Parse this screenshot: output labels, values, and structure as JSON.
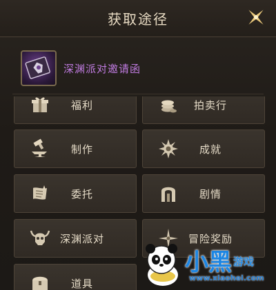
{
  "header": {
    "title": "获取途径"
  },
  "item": {
    "name": "深渊派对邀请函"
  },
  "sources": [
    {
      "label": "福利",
      "icon": "gift-icon"
    },
    {
      "label": "拍卖行",
      "icon": "coin-stack-icon"
    },
    {
      "label": "制作",
      "icon": "anvil-hammer-icon"
    },
    {
      "label": "成就",
      "icon": "medal-icon"
    },
    {
      "label": "委托",
      "icon": "scroll-icon"
    },
    {
      "label": "剧情",
      "icon": "gate-icon"
    },
    {
      "label": "深渊派对",
      "icon": "horned-skull-icon"
    },
    {
      "label": "冒险奖励",
      "icon": "compass-star-icon"
    },
    {
      "label": "道具",
      "icon": "chest-icon"
    }
  ],
  "watermark": {
    "brand": "小黑",
    "sub": "游戏",
    "url": "www.xiaohei.com"
  },
  "colors": {
    "item_name": "#c07be0",
    "label": "#e6dcc8",
    "title": "#e9dcc4",
    "watermark": "#1d86e3"
  }
}
